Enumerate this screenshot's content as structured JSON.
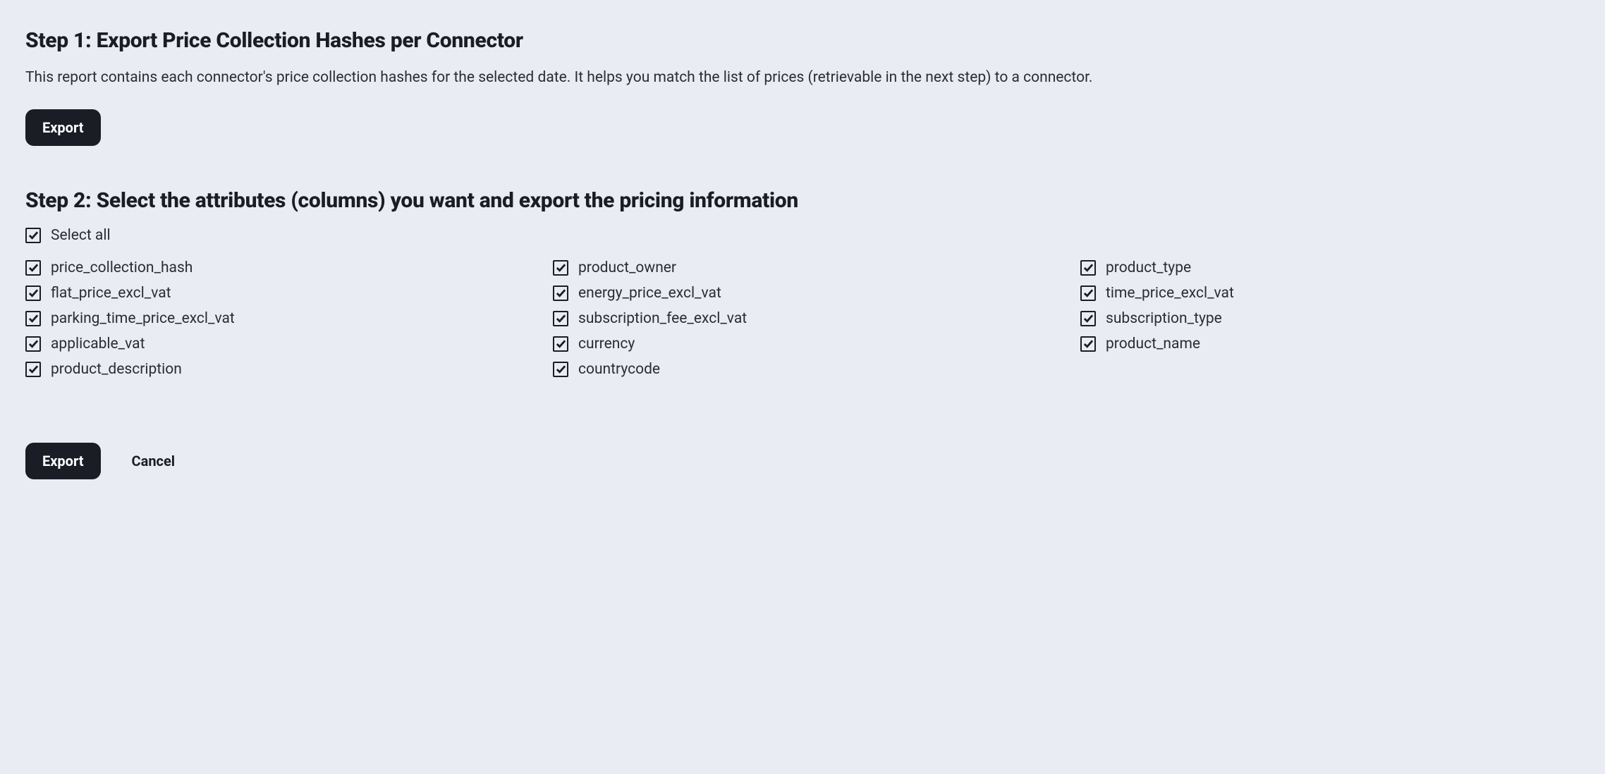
{
  "step1": {
    "heading": "Step 1: Export Price Collection Hashes per Connector",
    "description": "This report contains each connector's price collection hashes for the selected date. It helps you match the list of prices (retrievable in the next step) to a connector.",
    "export_label": "Export"
  },
  "step2": {
    "heading": "Step 2: Select the attributes (columns) you want and export the pricing information",
    "select_all_label": "Select all",
    "attributes": [
      "price_collection_hash",
      "product_owner",
      "product_type",
      "flat_price_excl_vat",
      "energy_price_excl_vat",
      "time_price_excl_vat",
      "parking_time_price_excl_vat",
      "subscription_fee_excl_vat",
      "subscription_type",
      "applicable_vat",
      "currency",
      "product_name",
      "product_description",
      "countrycode"
    ],
    "export_label": "Export",
    "cancel_label": "Cancel"
  }
}
